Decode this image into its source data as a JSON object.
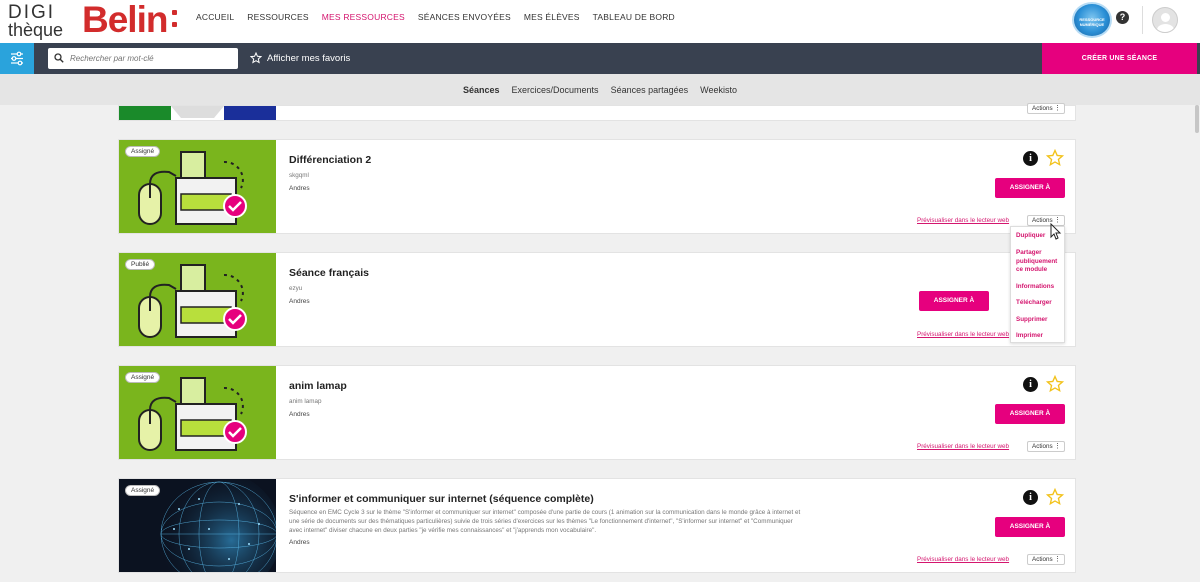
{
  "brand": {
    "line1": "DIGI",
    "line2": "thèque",
    "name": "Belin",
    "accent": "#d22c2c"
  },
  "nav": {
    "items": [
      {
        "label": "ACCUEIL",
        "active": false
      },
      {
        "label": "RESSOURCES",
        "active": false
      },
      {
        "label": "MES RESSOURCES",
        "active": true
      },
      {
        "label": "SÉANCES ENVOYÉES",
        "active": false
      },
      {
        "label": "MES ÉLÈVES",
        "active": false
      },
      {
        "label": "TABLEAU DE BORD",
        "active": false
      }
    ]
  },
  "header": {
    "seal_text": "RESSOURCE NUMÉRIQUE",
    "help": "?"
  },
  "search": {
    "placeholder": "Rechercher par mot-clé",
    "favorites_label": "Afficher mes favoris",
    "create_label": "CRÉER UNE SÉANCE"
  },
  "tabs": [
    {
      "label": "Séances",
      "active": true
    },
    {
      "label": "Exercices/Documents",
      "active": false
    },
    {
      "label": "Séances partagées",
      "active": false
    },
    {
      "label": "Weekisto",
      "active": false
    }
  ],
  "cards": {
    "c0": {
      "actions": "Actions"
    },
    "c1": {
      "status": "Assigné",
      "title": "Différenciation 2",
      "desc": "skgqml",
      "author": "Andres",
      "assign": "ASSIGNER À",
      "preview": "Prévisualiser dans le lecteur web",
      "actions": "Actions",
      "info": "i"
    },
    "c2": {
      "status": "Publié",
      "title": "Séance français",
      "desc": "ezyu",
      "author": "Andres",
      "assign": "ASSIGNER À",
      "preview": "Prévisualiser dans le lecteur web"
    },
    "c3": {
      "status": "Assigné",
      "title": "anim lamap",
      "desc": "anim lamap",
      "author": "Andres",
      "assign": "ASSIGNER À",
      "preview": "Prévisualiser dans le lecteur web",
      "actions": "Actions",
      "info": "i"
    },
    "c4": {
      "status": "Assigné",
      "title": "S'informer et communiquer sur internet (séquence complète)",
      "desc": "Séquence en EMC Cycle 3 sur le thème \"S'informer et communiquer sur internet\" composée d'une partie de cours (1 animation sur la communication dans le monde grâce à internet et une série de documents sur des thématiques particulières) suivie de trois séries d'exercices sur les thèmes \"Le fonctionnement d'internet\", \"S'informer sur internet\" et \"Communiquer avec internet\" diviser chacune en deux parties \"je vérifie mes connaissances\" et \"j'apprends mon vocabulaire\".",
      "author": "Andres",
      "assign": "ASSIGNER À",
      "preview": "Prévisualiser dans le lecteur web",
      "actions": "Actions",
      "info": "i"
    }
  },
  "actions_menu": {
    "items": [
      "Dupliquer",
      "Partager publiquement ce module",
      "Informations",
      "Télécharger",
      "Supprimer",
      "Imprimer"
    ]
  },
  "colors": {
    "primary": "#e6007e",
    "link": "#d4156e",
    "blue": "#2aa3dc",
    "dark_bar": "#394150",
    "thumb_green": "#7ab51d"
  }
}
